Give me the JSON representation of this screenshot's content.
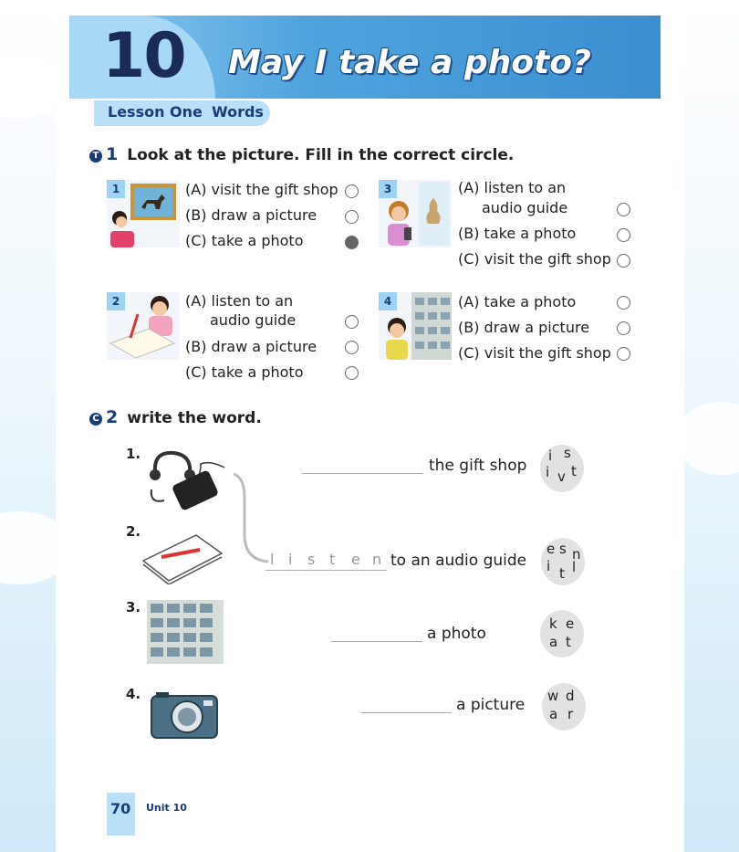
{
  "header": {
    "unit_number": "10",
    "title": "May I take a photo?",
    "lesson": "Lesson One",
    "lesson_type": "Words"
  },
  "section1": {
    "badge": "T",
    "number": "1",
    "instruction": "Look at the picture. Fill in the correct circle.",
    "items": [
      {
        "num": "1",
        "options": [
          "(A) visit the gift shop",
          "(B) draw a picture",
          "(C) take a photo"
        ],
        "selected": 2
      },
      {
        "num": "2",
        "options": [
          "(A) listen to an",
          "audio guide",
          "(B) draw a picture",
          "(C) take a photo"
        ],
        "selected": -1
      },
      {
        "num": "3",
        "options": [
          "(A) listen to an",
          "audio guide",
          "(B) take a photo",
          "(C) visit the gift shop"
        ],
        "selected": -1
      },
      {
        "num": "4",
        "options": [
          "(A) take a photo",
          "(B) draw a picture",
          "(C) visit the gift shop"
        ],
        "selected": -1
      }
    ]
  },
  "section2": {
    "badge": "C",
    "number": "2",
    "instruction": "write the word.",
    "items": [
      {
        "num": "1.",
        "phrase": "the gift shop",
        "letters": [
          "i",
          "s",
          "i",
          "v",
          "t"
        ]
      },
      {
        "num": "2.",
        "phrase": "to an audio guide",
        "example": [
          "l",
          "i",
          "s",
          "t",
          "e",
          "n"
        ],
        "letters": [
          "e",
          "s",
          "n",
          "i",
          "t",
          "l"
        ]
      },
      {
        "num": "3.",
        "phrase": "a photo",
        "letters": [
          "k",
          "e",
          "a",
          "t"
        ]
      },
      {
        "num": "4.",
        "phrase": "a picture",
        "letters": [
          "w",
          "d",
          "a",
          "r"
        ]
      }
    ]
  },
  "footer": {
    "page_number": "70",
    "unit_label": "Unit 10"
  },
  "colors": {
    "navy": "#1a3c78",
    "banner": "#4fa3dd",
    "light_blue": "#b9e0f7"
  }
}
